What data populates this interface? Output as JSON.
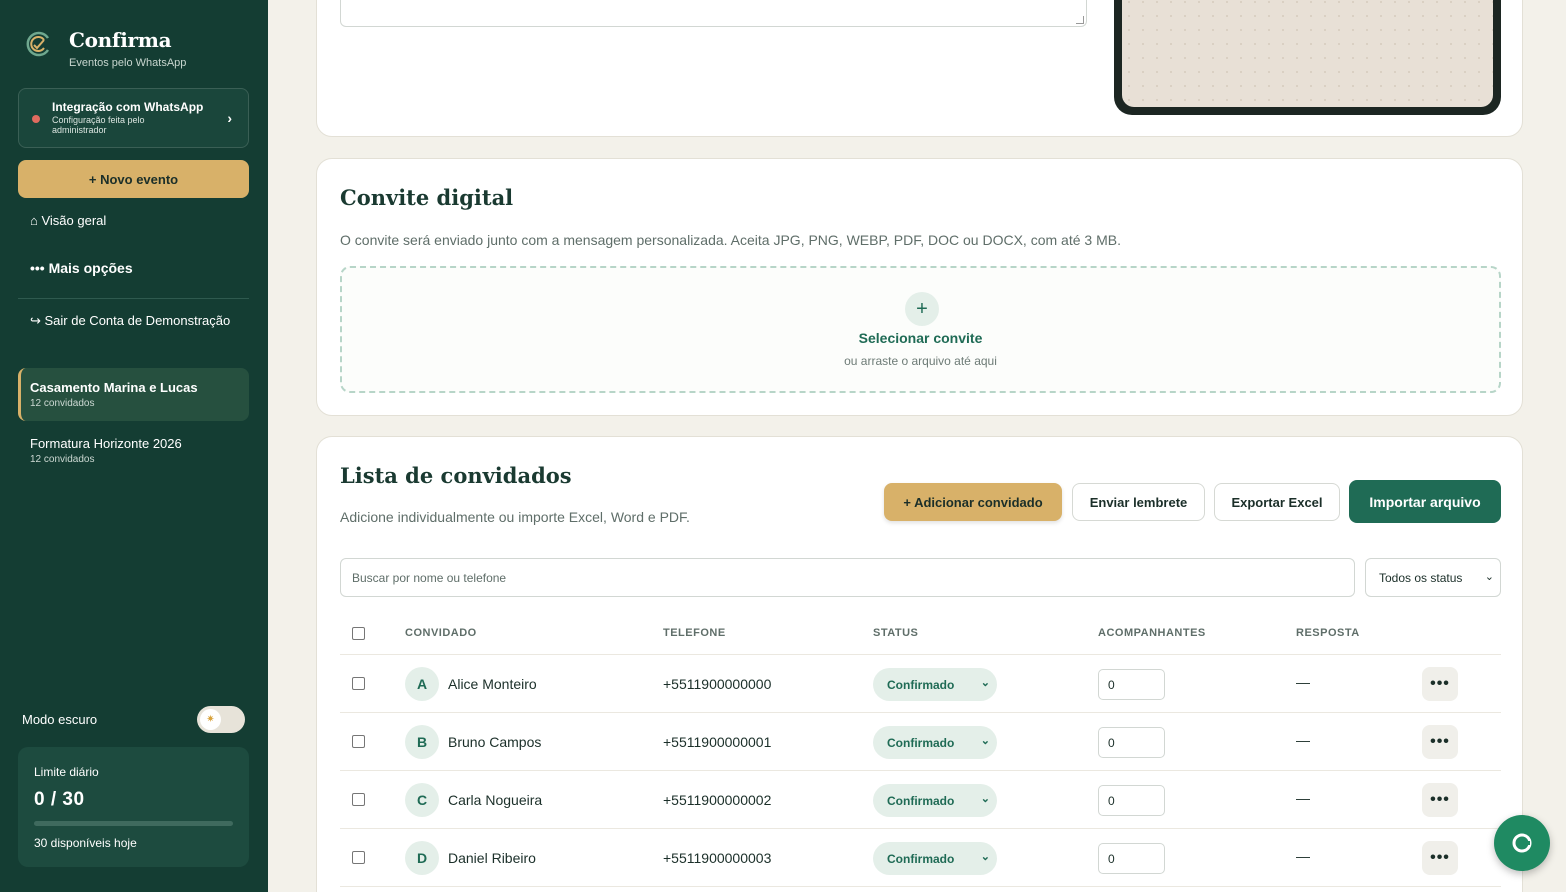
{
  "brand": {
    "name": "Confirma",
    "subtitle": "Eventos pelo WhatsApp"
  },
  "integration": {
    "title": "Integração com WhatsApp",
    "subtitle": "Configuração feita pelo administrador",
    "chevron": "›",
    "status_color": "#e06b5f"
  },
  "sidebar": {
    "new_event": "+  Novo evento",
    "overview": "⌂ Visão geral",
    "more_options": "••• Mais opções",
    "exit": "↪ Sair de Conta de Demonstração",
    "events": [
      {
        "name": "Casamento Marina e Lucas",
        "count": "12 convidados",
        "active": true
      },
      {
        "name": "Formatura Horizonte 2026",
        "count": "12 convidados",
        "active": false
      }
    ],
    "dark_mode_label": "Modo escuro",
    "limit": {
      "title": "Limite diário",
      "value": "0 / 30",
      "progress": 0,
      "available": "30 disponíveis hoje"
    }
  },
  "convite": {
    "title": "Convite digital",
    "description": "O convite será enviado junto com a mensagem personalizada. Aceita JPG, PNG, WEBP, PDF, DOC ou DOCX, com até 3 MB.",
    "drop_plus": "+",
    "drop_title": "Selecionar convite",
    "drop_sub": "ou arraste o arquivo até aqui"
  },
  "guests": {
    "title": "Lista de convidados",
    "description": "Adicione individualmente ou importe Excel, Word e PDF.",
    "buttons": {
      "add": "+ Adicionar convidado",
      "remind": "Enviar lembrete",
      "export": "Exportar Excel",
      "import": "Importar arquivo"
    },
    "search_placeholder": "Buscar por nome ou telefone",
    "status_filter": "Todos os status",
    "columns": {
      "guest": "CONVIDADO",
      "phone": "TELEFONE",
      "status": "STATUS",
      "companions": "ACOMPANHANTES",
      "response": "RESPOSTA"
    },
    "rows": [
      {
        "initial": "A",
        "name": "Alice Monteiro",
        "phone": "+5511900000000",
        "status": "Confirmado",
        "companions": "0",
        "response": "—"
      },
      {
        "initial": "B",
        "name": "Bruno Campos",
        "phone": "+5511900000001",
        "status": "Confirmado",
        "companions": "0",
        "response": "—"
      },
      {
        "initial": "C",
        "name": "Carla Nogueira",
        "phone": "+5511900000002",
        "status": "Confirmado",
        "companions": "0",
        "response": "—"
      },
      {
        "initial": "D",
        "name": "Daniel Ribeiro",
        "phone": "+5511900000003",
        "status": "Confirmado",
        "companions": "0",
        "response": "—"
      }
    ],
    "more_label": "•••"
  },
  "colors": {
    "sidebar": "#143d33",
    "accent": "#d8b169",
    "primary": "#1f6b55"
  }
}
